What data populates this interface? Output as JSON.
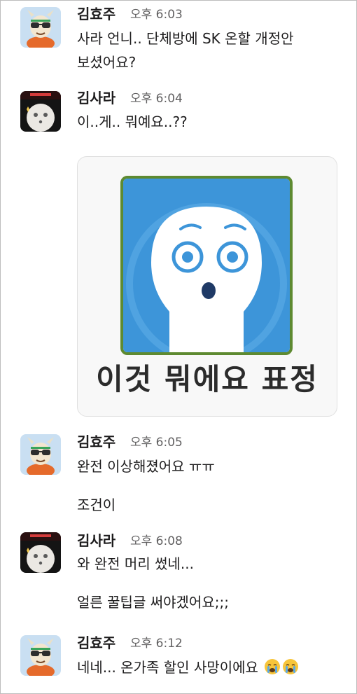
{
  "messages": [
    {
      "sender": "김효주",
      "time": "오후 6:03",
      "lines": [
        "사라 언니.. 단체방에 SK 온할 개정안",
        "보셨어요?"
      ]
    },
    {
      "sender": "김사라",
      "time": "오후 6:04",
      "lines": [
        "이..게.. 뭐예요..??"
      ]
    },
    {
      "sticker_caption": "이것 뭐에요 표정"
    },
    {
      "sender": "김효주",
      "time": "오후 6:05",
      "lines": [
        "완전 이상해졌어요 ㅠㅠ",
        "조건이"
      ]
    },
    {
      "sender": "김사라",
      "time": "오후 6:08",
      "lines": [
        "와 완전 머리 썼네...",
        "얼른 꿀팁글 써야겠어요;;;"
      ]
    },
    {
      "sender": "김효주",
      "time": "오후 6:12",
      "lines": [
        "네네... 온가족 할인 사망이에요"
      ]
    }
  ],
  "avatar_hyoju": {
    "icon": "cartoon-goat-avatar-icon"
  },
  "avatar_sara": {
    "icon": "white-figure-avatar-icon"
  },
  "emoji": {
    "icon": "crying-face-emoji"
  }
}
